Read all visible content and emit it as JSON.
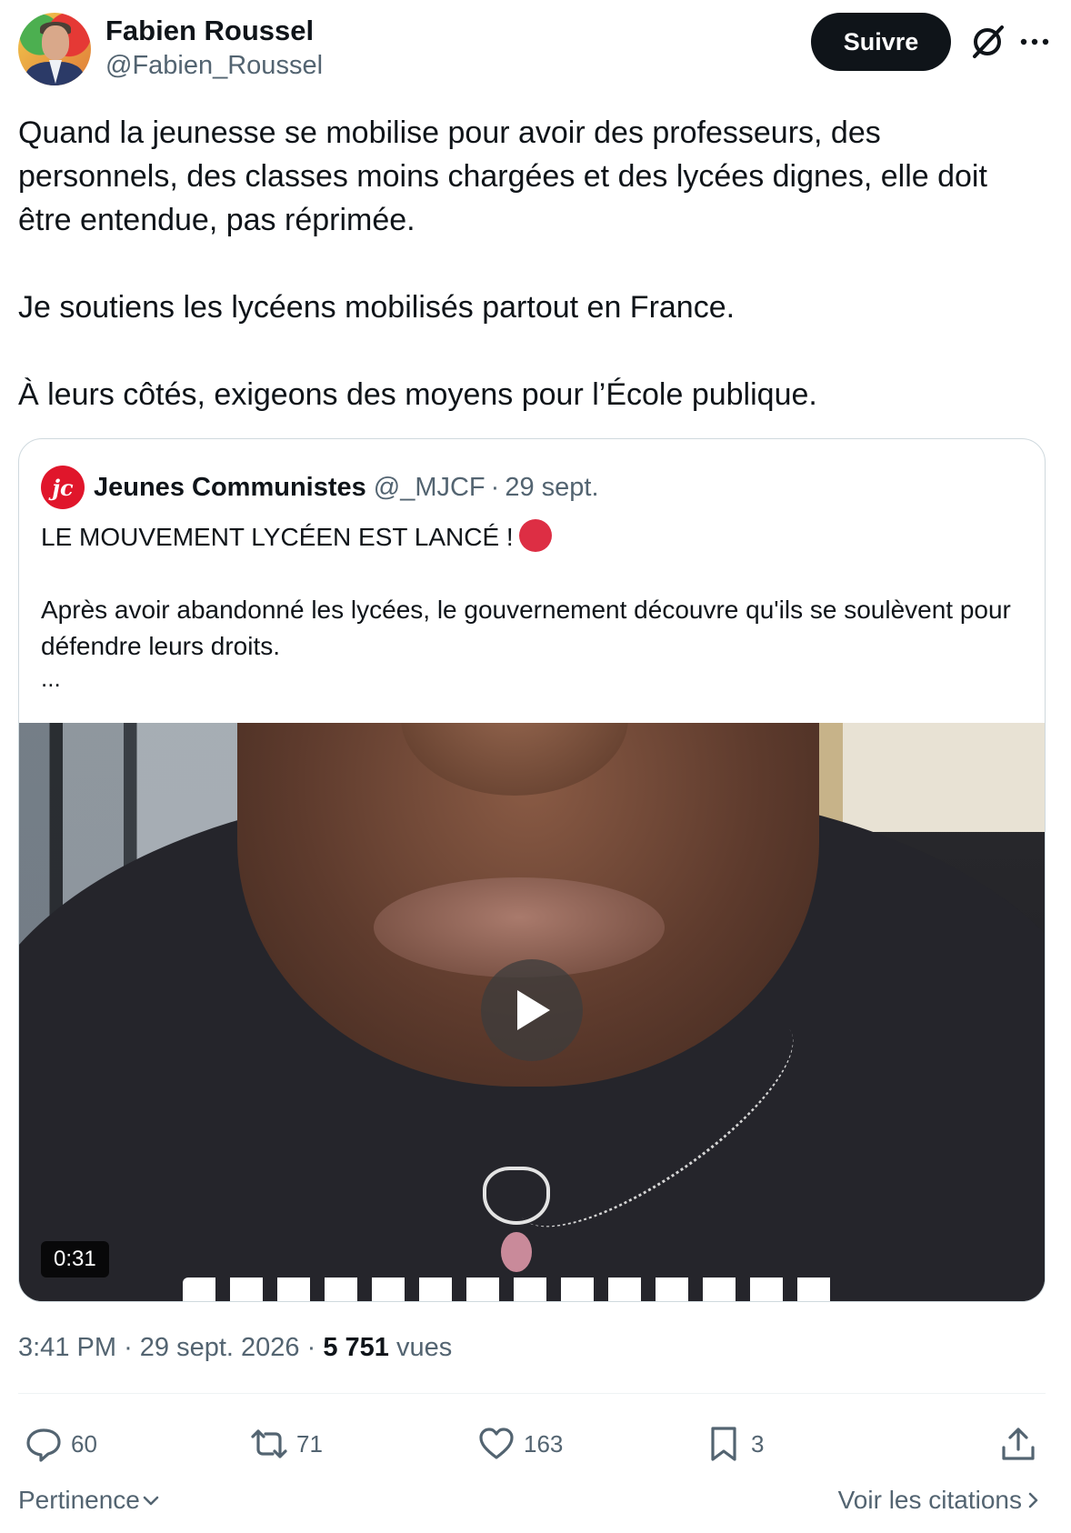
{
  "author": {
    "name": "Fabien Roussel",
    "handle": "@Fabien_Roussel",
    "follow_label": "Suivre"
  },
  "tweet": {
    "paragraphs": [
      "Quand la jeunesse se mobilise pour avoir des professeurs, des personnels, des classes moins chargées et des lycées dignes, elle doit être entendue, pas réprimée.",
      "Je soutiens les lycéens mobilisés partout en France.",
      "À leurs côtés, exigeons des moyens pour l’École publique."
    ]
  },
  "quote": {
    "logo_text": "jc",
    "name": "Jeunes Communistes",
    "handle": "@_MJCF",
    "separator": "·",
    "date": "29 sept.",
    "line1": "LE MOUVEMENT LYCÉEN EST LANCÉ !",
    "line2": "Après avoir abandonné les lycées, le gouvernement découvre qu'ils se soulèvent pour défendre leurs droits.",
    "ellipsis": "...",
    "video_duration": "0:31"
  },
  "meta": {
    "time": "3:41 PM",
    "separator": "·",
    "date": "29 sept. 2026",
    "views_count": "5 751",
    "views_label": "vues"
  },
  "actions": {
    "replies": "60",
    "reposts": "71",
    "likes": "163",
    "bookmarks": "3"
  },
  "footer": {
    "sort_label": "Pertinence",
    "quotes_label": "Voir les citations"
  },
  "colors": {
    "text_primary": "#0f1419",
    "text_secondary": "#536471",
    "border": "#cfd9de",
    "follow_bg": "#0f1419",
    "jc_red": "#e0162b",
    "red_circle": "#dd2e44"
  },
  "icons": [
    "grok-icon",
    "more-icon",
    "play-icon",
    "reply-icon",
    "repost-icon",
    "like-icon",
    "bookmark-icon",
    "share-icon",
    "chevron-down-icon",
    "chevron-right-icon"
  ]
}
